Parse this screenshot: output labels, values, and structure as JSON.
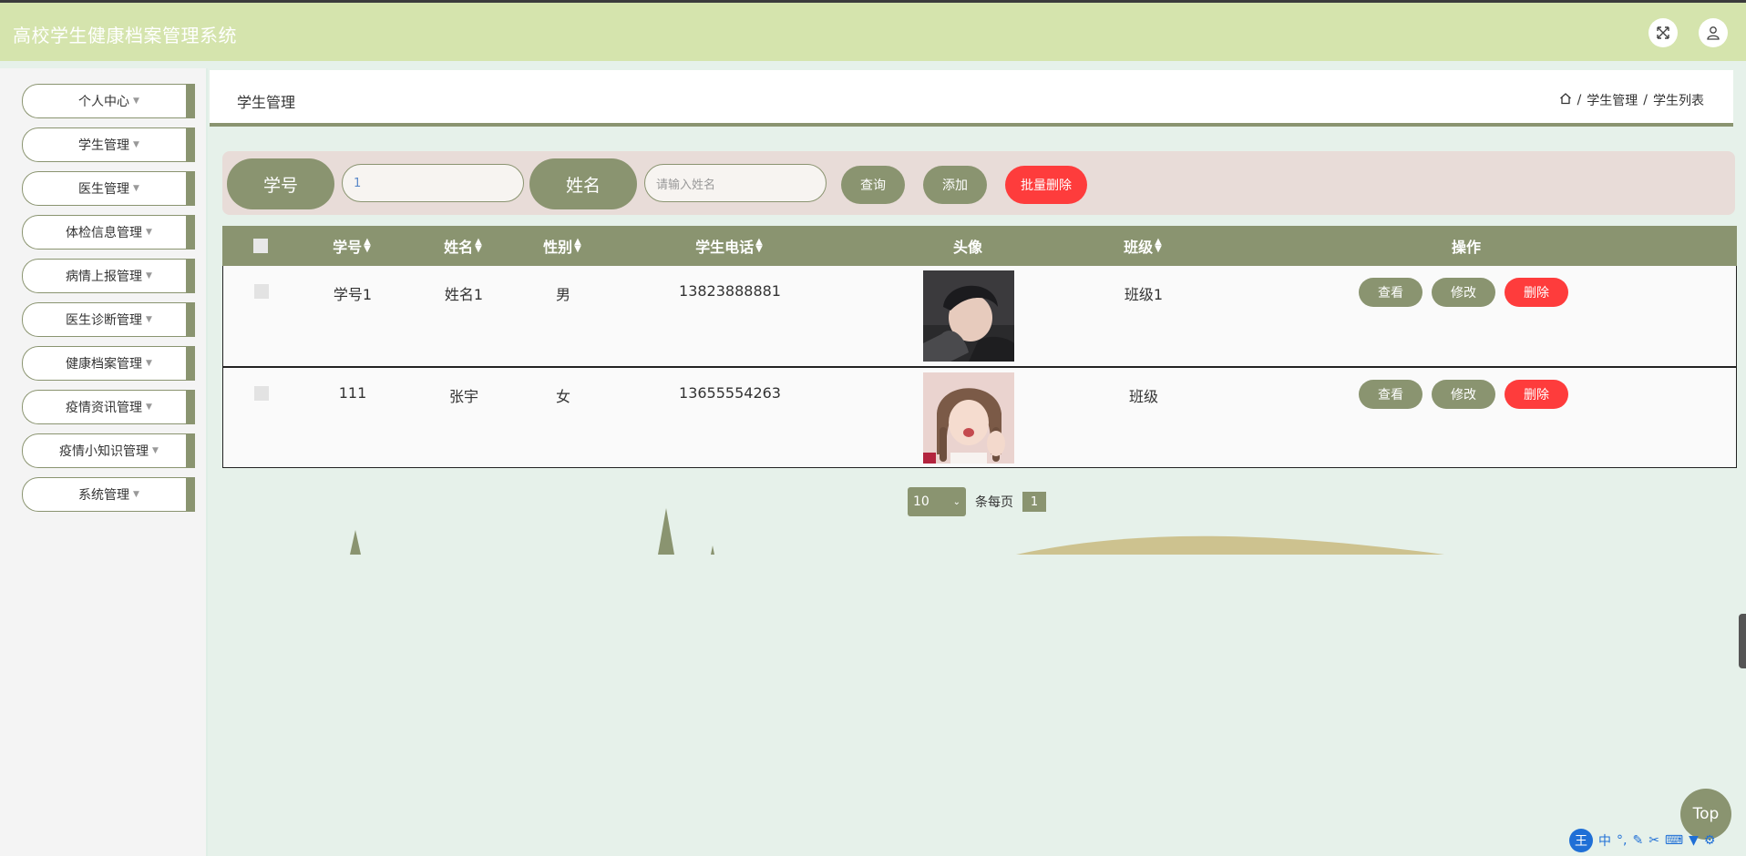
{
  "app": {
    "title": "高校学生健康档案管理系统"
  },
  "topbar": {
    "fullscreen_icon": "fullscreen-icon",
    "user_icon": "user-icon"
  },
  "sidebar": {
    "items": [
      {
        "label": "个人中心"
      },
      {
        "label": "学生管理"
      },
      {
        "label": "医生管理"
      },
      {
        "label": "体检信息管理"
      },
      {
        "label": "病情上报管理"
      },
      {
        "label": "医生诊断管理"
      },
      {
        "label": "健康档案管理"
      },
      {
        "label": "疫情资讯管理"
      },
      {
        "label": "疫情小知识管理"
      },
      {
        "label": "系统管理"
      }
    ]
  },
  "header": {
    "title": "学生管理",
    "breadcrumb": {
      "sep": "/",
      "level1": "学生管理",
      "level2": "学生列表"
    }
  },
  "search": {
    "id_label": "学号",
    "id_value": "1",
    "name_label": "姓名",
    "name_placeholder": "请输入姓名",
    "query_label": "查询",
    "add_label": "添加",
    "batch_delete_label": "批量删除"
  },
  "table": {
    "columns": [
      "学号",
      "姓名",
      "性别",
      "学生电话",
      "头像",
      "班级",
      "操作"
    ],
    "rows": [
      {
        "id": "学号1",
        "name": "姓名1",
        "gender": "男",
        "phone": "13823888881",
        "class": "班级1"
      },
      {
        "id": "111",
        "name": "张宇",
        "gender": "女",
        "phone": "13655554263",
        "class": "班级"
      }
    ],
    "actions": {
      "view": "查看",
      "edit": "修改",
      "delete": "删除"
    }
  },
  "pagination": {
    "page_size": "10",
    "per_page_label": "条每页",
    "current_page": "1"
  },
  "floating": {
    "top_label": "Top"
  },
  "ime": {
    "logo": "王",
    "mode": "中"
  },
  "colors": {
    "accent": "#8a9470",
    "danger": "#fe3c3c",
    "topbar": "#d5e4ad",
    "background": "#e6f1ea"
  }
}
